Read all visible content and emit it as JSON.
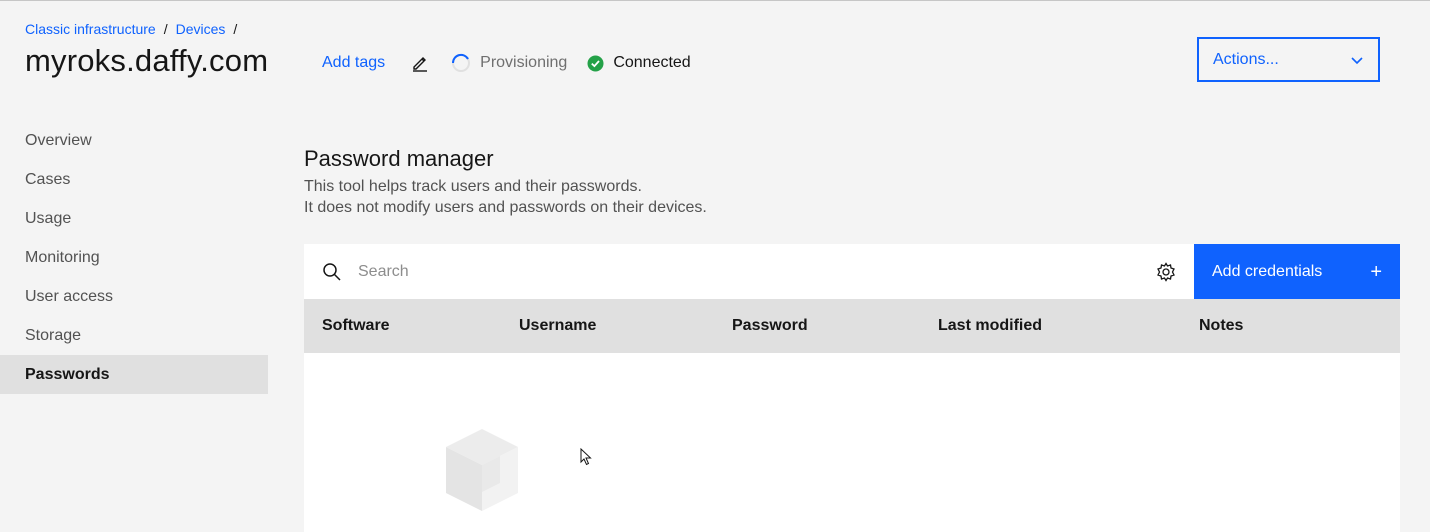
{
  "breadcrumb": {
    "items": [
      "Classic infrastructure",
      "Devices"
    ],
    "separator": "/"
  },
  "page": {
    "title": "myroks.daffy.com"
  },
  "header": {
    "add_tags": "Add tags",
    "edit_icon": "pencil-icon",
    "status_provisioning": "Provisioning",
    "status_connected": "Connected",
    "status_connected_color": "#24a148",
    "actions_label": "Actions..."
  },
  "sidebar": {
    "items": [
      {
        "label": "Overview"
      },
      {
        "label": "Cases"
      },
      {
        "label": "Usage"
      },
      {
        "label": "Monitoring"
      },
      {
        "label": "User access"
      },
      {
        "label": "Storage"
      },
      {
        "label": "Passwords",
        "active": true
      }
    ]
  },
  "password_manager": {
    "title": "Password manager",
    "desc_line1": "This tool helps track users and their passwords.",
    "desc_line2": "It does not modify users and passwords on their devices."
  },
  "toolbar": {
    "search_placeholder": "Search",
    "search_value": "",
    "settings_icon": "gear-icon",
    "add_label": "Add credentials",
    "add_icon": "+"
  },
  "table": {
    "columns": [
      "Software",
      "Username",
      "Password",
      "Last modified",
      "Notes"
    ],
    "rows": []
  },
  "colors": {
    "accent": "#0f62fe",
    "background": "#f4f4f4",
    "table_header": "#e0e0e0"
  }
}
